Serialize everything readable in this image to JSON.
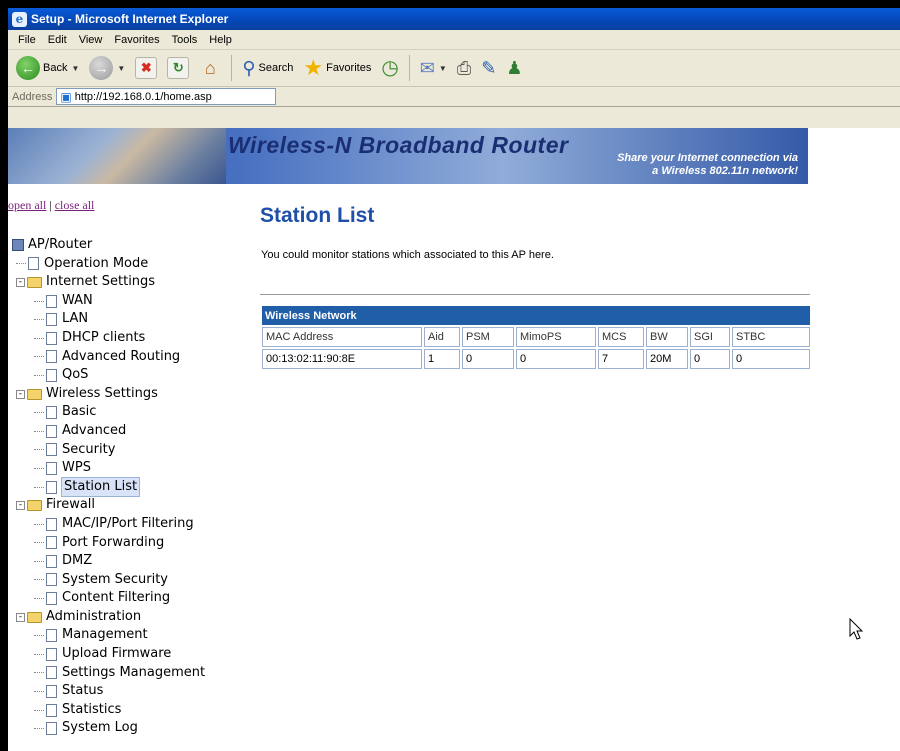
{
  "window": {
    "title": "Setup - Microsoft Internet Explorer"
  },
  "menubar": [
    "File",
    "Edit",
    "View",
    "Favorites",
    "Tools",
    "Help"
  ],
  "toolbar": {
    "back_label": "Back",
    "search_label": "Search",
    "favorites_label": "Favorites"
  },
  "address": {
    "label": "Address",
    "url": "http://192.168.0.1/home.asp"
  },
  "banner": {
    "title": "Wireless-N Broadband Router",
    "subtitle_line1": "Share your Internet connection via",
    "subtitle_line2": "a Wireless 802.11n network!"
  },
  "links": {
    "open_all": "open all",
    "separator": "|",
    "close_all": "close all"
  },
  "tree": {
    "root": "AP/Router",
    "operation_mode": "Operation Mode",
    "internet_settings": "Internet Settings",
    "wan": "WAN",
    "lan": "LAN",
    "dhcp_clients": "DHCP clients",
    "advanced_routing": "Advanced Routing",
    "qos": "QoS",
    "wireless_settings": "Wireless Settings",
    "basic": "Basic",
    "advanced": "Advanced",
    "security": "Security",
    "wps": "WPS",
    "station_list": "Station List",
    "firewall": "Firewall",
    "mac_ip_port_filtering": "MAC/IP/Port Filtering",
    "port_forwarding": "Port Forwarding",
    "dmz": "DMZ",
    "system_security": "System Security",
    "content_filtering": "Content Filtering",
    "administration": "Administration",
    "management": "Management",
    "upload_firmware": "Upload Firmware",
    "settings_management": "Settings Management",
    "status": "Status",
    "statistics": "Statistics",
    "system_log": "System Log"
  },
  "main": {
    "heading": "Station List",
    "description": "You could monitor stations which associated to this AP here.",
    "table_title": "Wireless Network",
    "columns": [
      "MAC Address",
      "Aid",
      "PSM",
      "MimoPS",
      "MCS",
      "BW",
      "SGI",
      "STBC"
    ],
    "rows": [
      [
        "00:13:02:11:90:8E",
        "1",
        "0",
        "0",
        "7",
        "20M",
        "0",
        "0"
      ]
    ]
  }
}
